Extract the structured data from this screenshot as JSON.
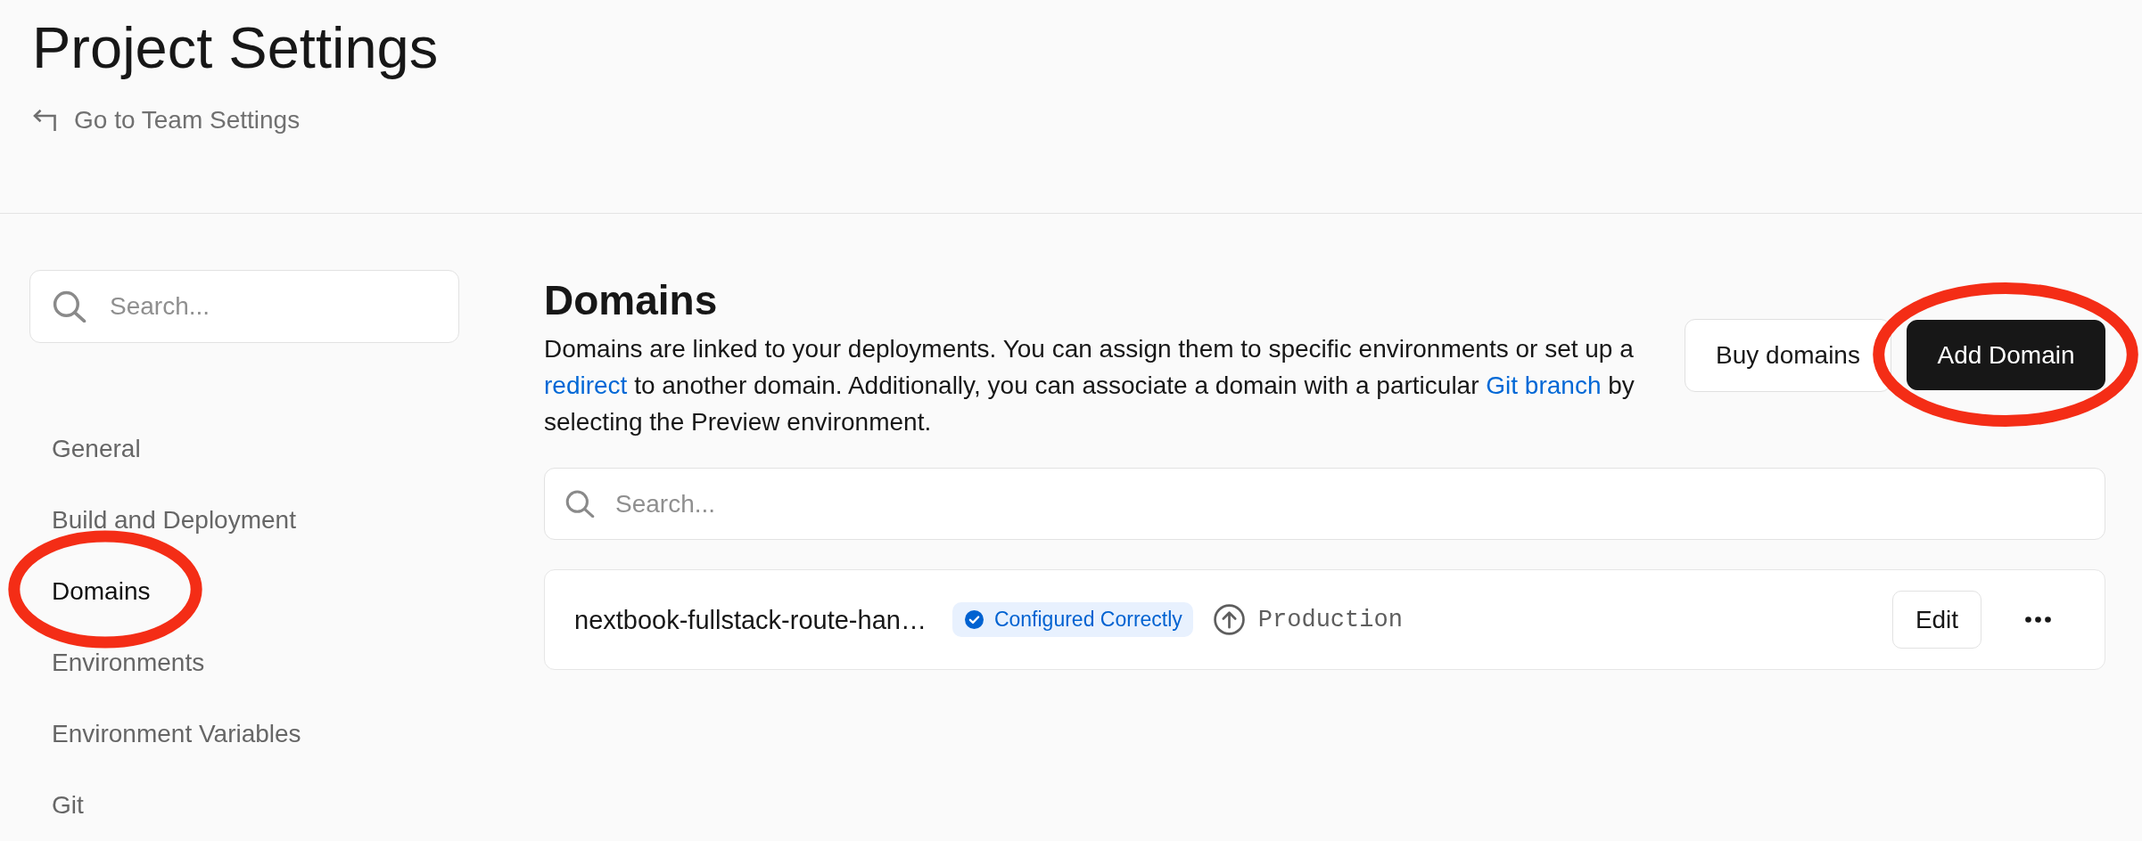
{
  "header": {
    "title": "Project Settings",
    "back_link": "Go to Team Settings"
  },
  "sidebar": {
    "search": {
      "placeholder": "Search..."
    },
    "items": [
      {
        "label": "General",
        "selected": false,
        "circled": false
      },
      {
        "label": "Build and Deployment",
        "selected": false,
        "circled": false
      },
      {
        "label": "Domains",
        "selected": true,
        "circled": true
      },
      {
        "label": "Environments",
        "selected": false,
        "circled": false
      },
      {
        "label": "Environment Variables",
        "selected": false,
        "circled": false
      },
      {
        "label": "Git",
        "selected": false,
        "circled": false
      }
    ]
  },
  "domains": {
    "heading": "Domains",
    "description": [
      {
        "kind": "text",
        "text": "Domains are linked to your deployments. You can assign them to specific environments or set up a "
      },
      {
        "kind": "link",
        "text": "redirect"
      },
      {
        "kind": "text",
        "text": " to another domain. Additionally, you can associate a domain with a particular "
      },
      {
        "kind": "link",
        "text": "Git branch"
      },
      {
        "kind": "text",
        "text": " by selecting the Preview environment."
      }
    ],
    "buttons": [
      {
        "label": "Buy domains",
        "kind": "secondary",
        "circled": false
      },
      {
        "label": "Add Domain",
        "kind": "primary",
        "circled": true
      }
    ],
    "search": {
      "placeholder": "Search..."
    },
    "rows": [
      {
        "name": "nextbook-fullstack-route-han…",
        "status": "Configured Correctly",
        "environment": "Production",
        "edit": "Edit"
      }
    ]
  }
}
